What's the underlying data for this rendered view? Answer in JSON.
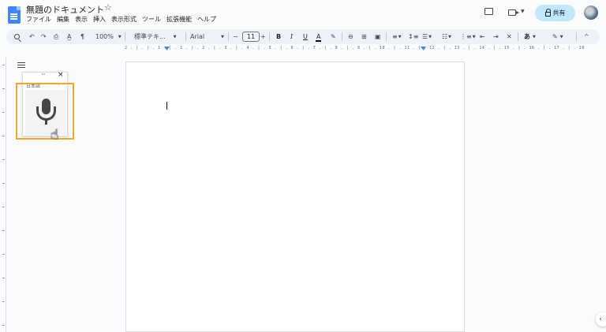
{
  "header": {
    "doc_title": "無題のドキュメント",
    "star_icon": "star-outline-icon",
    "menus": [
      "ファイル",
      "編集",
      "表示",
      "挿入",
      "表示形式",
      "ツール",
      "拡張機能",
      "ヘルプ"
    ],
    "share_label": "共有",
    "icons": [
      "comment-history-icon",
      "meet-icon",
      "lock-icon",
      "avatar"
    ]
  },
  "toolbar": {
    "zoom": "100%",
    "style": "標準テキ...",
    "font": "Arial",
    "minus": "−",
    "font_size": "11",
    "plus": "+",
    "bold": "B",
    "italic": "I",
    "underline": "U",
    "text_color": "A",
    "ime": "あ",
    "collapse": "^"
  },
  "ruler": {
    "text": "2 . | . | . 1 . | . 1 . | . 2 . | . 3 . | . 4 . | . 5 . | . 6 . | . 7 . | . 8 . | . 9 . | . 10 . | . 11 . | . 12 . | . 13 . | . 14 . | . 15 . | . 16 . | . 17 . | . 18"
  },
  "voice_typing": {
    "more": "···",
    "close": "×",
    "language": "日本語",
    "caret": "▾",
    "mic_icon": "microphone-icon"
  },
  "side_panel": {
    "toggle": "‹"
  },
  "colors": {
    "accent": "#0b57d0",
    "share_bg": "#c2e7ff",
    "highlight": "#f4a62a",
    "toolbar_bg": "#edf2fa",
    "doc_blue": "#4285f4"
  }
}
